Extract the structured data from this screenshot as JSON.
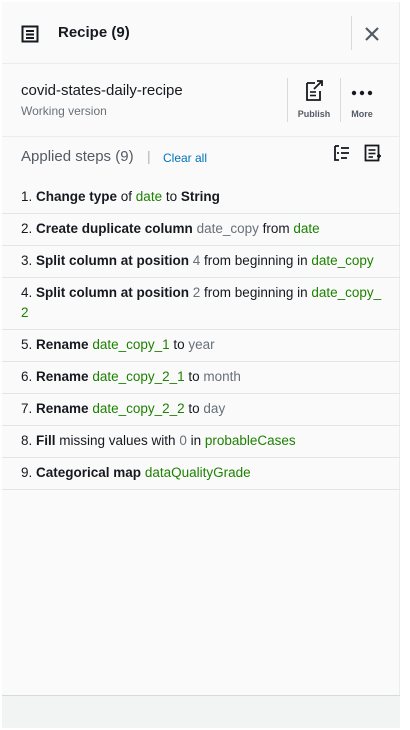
{
  "header": {
    "title": "Recipe (9)"
  },
  "recipe": {
    "name": "covid-states-daily-recipe",
    "version": "Working version"
  },
  "actions": {
    "publish_label": "Publish",
    "more_label": "More"
  },
  "steps_header": {
    "label": "Applied steps (9)",
    "separator": "|",
    "clear_all": "Clear all"
  },
  "steps": [
    {
      "parts": [
        {
          "s": "t",
          "v": "1. "
        },
        {
          "s": "b",
          "v": "Change type"
        },
        {
          "s": "t",
          "v": " of "
        },
        {
          "s": "g",
          "v": "date"
        },
        {
          "s": "t",
          "v": " to "
        },
        {
          "s": "b",
          "v": "String"
        }
      ]
    },
    {
      "parts": [
        {
          "s": "t",
          "v": "2. "
        },
        {
          "s": "b",
          "v": "Create duplicate column"
        },
        {
          "s": "t",
          "v": " "
        },
        {
          "s": "m",
          "v": "date_copy"
        },
        {
          "s": "t",
          "v": " from "
        },
        {
          "s": "g",
          "v": "date"
        }
      ]
    },
    {
      "parts": [
        {
          "s": "t",
          "v": "3. "
        },
        {
          "s": "b",
          "v": "Split column at position"
        },
        {
          "s": "t",
          "v": " "
        },
        {
          "s": "m",
          "v": "4"
        },
        {
          "s": "t",
          "v": " from beginning  in "
        },
        {
          "s": "g",
          "v": "date_copy"
        }
      ]
    },
    {
      "parts": [
        {
          "s": "t",
          "v": "4. "
        },
        {
          "s": "b",
          "v": "Split column at position"
        },
        {
          "s": "t",
          "v": " "
        },
        {
          "s": "m",
          "v": "2"
        },
        {
          "s": "t",
          "v": " from beginning  in "
        },
        {
          "s": "g",
          "v": "date_copy_2"
        }
      ]
    },
    {
      "parts": [
        {
          "s": "t",
          "v": "5. "
        },
        {
          "s": "b",
          "v": "Rename"
        },
        {
          "s": "t",
          "v": " "
        },
        {
          "s": "g",
          "v": "date_copy_1"
        },
        {
          "s": "t",
          "v": " to "
        },
        {
          "s": "m",
          "v": "year"
        }
      ]
    },
    {
      "parts": [
        {
          "s": "t",
          "v": "6. "
        },
        {
          "s": "b",
          "v": "Rename"
        },
        {
          "s": "t",
          "v": " "
        },
        {
          "s": "g",
          "v": "date_copy_2_1"
        },
        {
          "s": "t",
          "v": " to "
        },
        {
          "s": "m",
          "v": "month"
        }
      ]
    },
    {
      "parts": [
        {
          "s": "t",
          "v": "7. "
        },
        {
          "s": "b",
          "v": "Rename"
        },
        {
          "s": "t",
          "v": " "
        },
        {
          "s": "g",
          "v": "date_copy_2_2"
        },
        {
          "s": "t",
          "v": " to "
        },
        {
          "s": "m",
          "v": "day"
        }
      ]
    },
    {
      "parts": [
        {
          "s": "t",
          "v": "8. "
        },
        {
          "s": "b",
          "v": "Fill"
        },
        {
          "s": "t",
          "v": " missing values with "
        },
        {
          "s": "m",
          "v": "0"
        },
        {
          "s": "t",
          "v": " in "
        },
        {
          "s": "g",
          "v": "probableCases"
        }
      ]
    },
    {
      "parts": [
        {
          "s": "t",
          "v": "9. "
        },
        {
          "s": "b",
          "v": "Categorical map"
        },
        {
          "s": "t",
          "v": " "
        },
        {
          "s": "g",
          "v": "dataQualityGrade"
        }
      ]
    }
  ],
  "icons": {
    "recipe": "recipe-list-icon",
    "close": "close-icon",
    "publish": "publish-icon",
    "more": "more-dots-icon",
    "tool1": "expand-steps-icon",
    "tool2": "recipe-actions-icon"
  },
  "colors": {
    "link": "#0073bb",
    "value": "#1d8102",
    "muted": "#687078"
  }
}
